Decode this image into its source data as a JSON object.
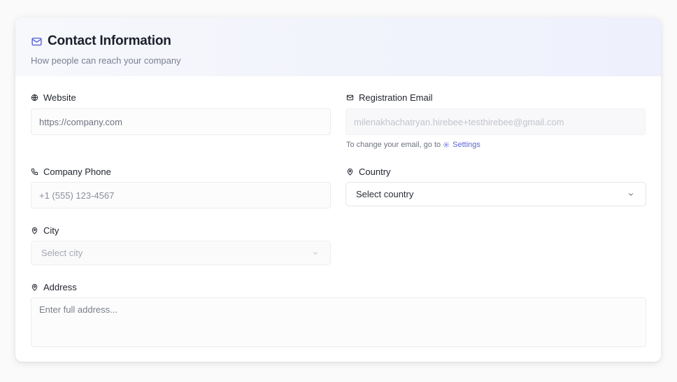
{
  "header": {
    "icon": "mail-icon",
    "title": "Contact Information",
    "subtitle": "How people can reach your company"
  },
  "fields": {
    "website": {
      "icon": "globe-icon",
      "label": "Website",
      "value": "https://company.com"
    },
    "registration_email": {
      "icon": "mail-icon",
      "label": "Registration Email",
      "value": "milenakhachatryan.hirebee+testhirebee@gmail.com",
      "helper_text": "To change your email, go to",
      "helper_link": "Settings",
      "helper_link_icon": "gear-icon"
    },
    "company_phone": {
      "icon": "phone-icon",
      "label": "Company Phone",
      "placeholder": "+1 (555) 123-4567"
    },
    "country": {
      "icon": "map-pin-icon",
      "label": "Country",
      "selected": "Select country"
    },
    "city": {
      "icon": "map-pin-icon",
      "label": "City",
      "selected": "Select city"
    },
    "address": {
      "icon": "map-pin-icon",
      "label": "Address",
      "placeholder": "Enter full address..."
    }
  },
  "colors": {
    "accent": "#5b63d6",
    "header_bg": "#f1f3fc"
  }
}
